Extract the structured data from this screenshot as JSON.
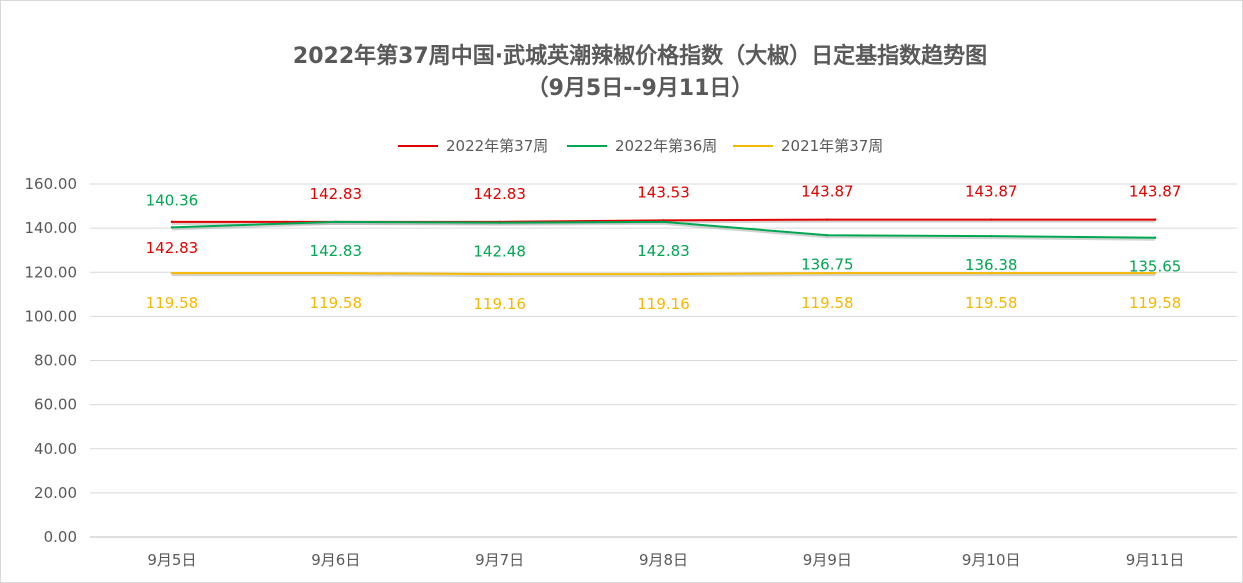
{
  "chart_data": {
    "type": "line",
    "title": "2022年第37周中国·武城英潮辣椒价格指数（大椒）日定基指数趋势图",
    "subtitle": "（9月5日--9月11日）",
    "categories": [
      "9月5日",
      "9月6日",
      "9月7日",
      "9月8日",
      "9月9日",
      "9月10日",
      "9月11日"
    ],
    "ylim": [
      0,
      160
    ],
    "yticks": [
      "0.00",
      "20.00",
      "40.00",
      "60.00",
      "80.00",
      "100.00",
      "120.00",
      "140.00",
      "160.00"
    ],
    "grid": true,
    "legend_position": "top",
    "series": [
      {
        "name": "2022年第37周",
        "color": "#e00000",
        "values": [
          142.83,
          142.83,
          142.83,
          143.53,
          143.87,
          143.87,
          143.87
        ],
        "labels": [
          "142.83",
          "142.83",
          "142.83",
          "143.53",
          "143.87",
          "143.87",
          "143.87"
        ]
      },
      {
        "name": "2022年第36周",
        "color": "#00a651",
        "values": [
          140.36,
          142.83,
          142.48,
          142.83,
          136.75,
          136.38,
          135.65
        ],
        "labels": [
          "140.36",
          "142.83",
          "142.48",
          "142.83",
          "136.75",
          "136.38",
          "135.65"
        ]
      },
      {
        "name": "2021年第37周",
        "color": "#f5b800",
        "values": [
          119.58,
          119.58,
          119.16,
          119.16,
          119.58,
          119.58,
          119.58
        ],
        "labels": [
          "119.58",
          "119.58",
          "119.16",
          "119.16",
          "119.58",
          "119.58",
          "119.58"
        ]
      }
    ]
  }
}
